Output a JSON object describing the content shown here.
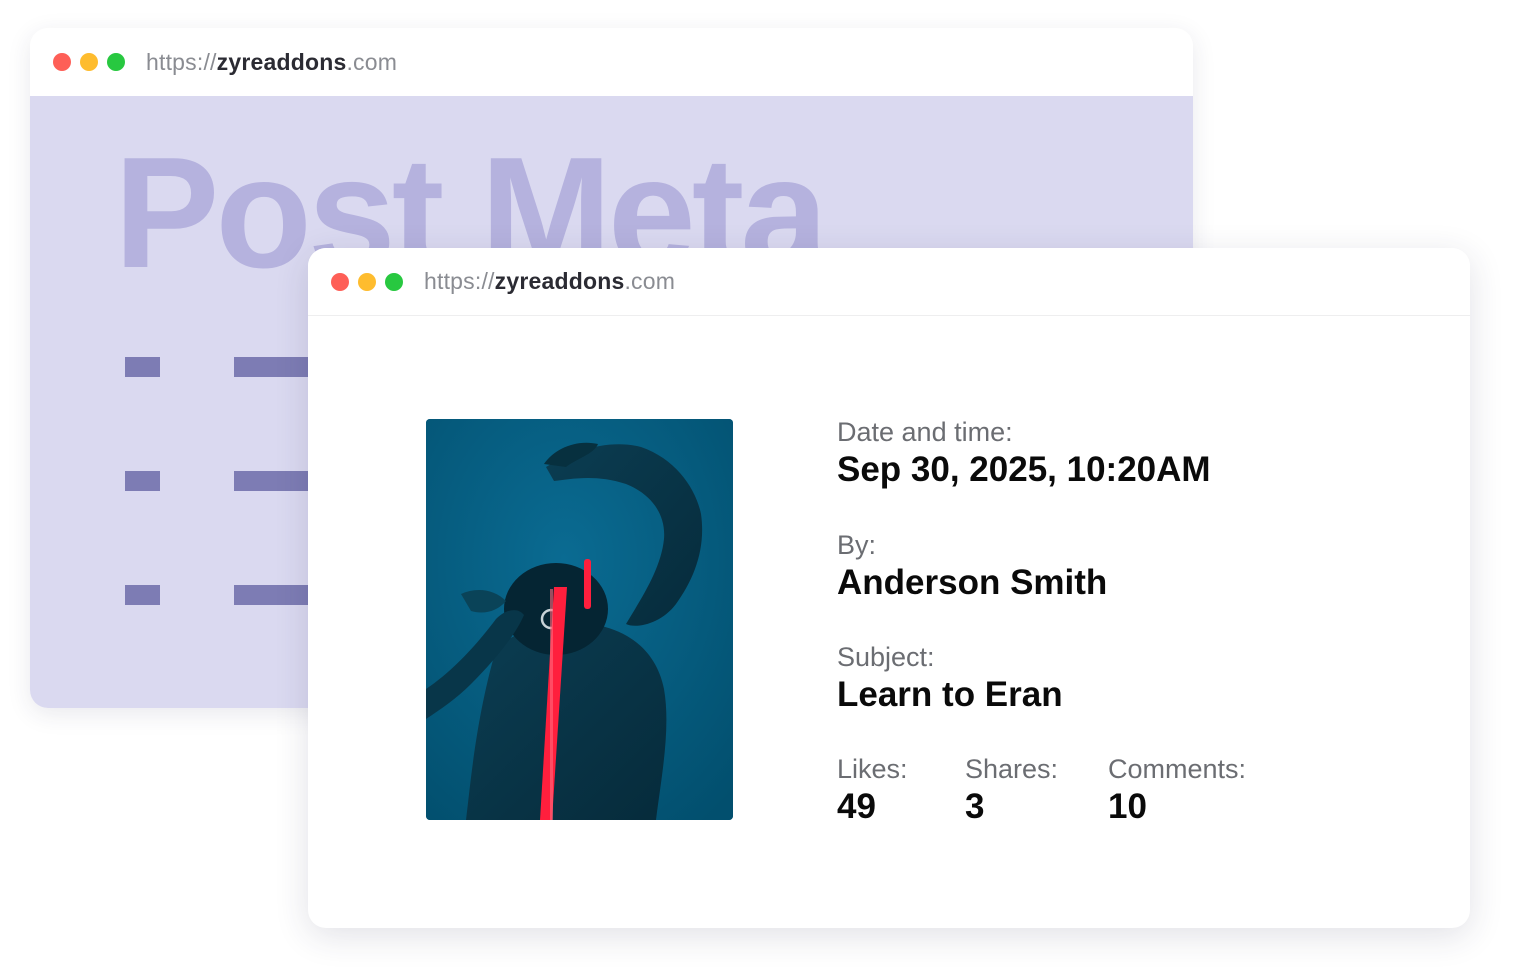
{
  "back_window": {
    "url_prefix": "https://",
    "url_domain": "zyreaddons",
    "url_suffix": ".com",
    "heading": "Post Meta"
  },
  "front_window": {
    "url_prefix": "https://",
    "url_domain": "zyreaddons",
    "url_suffix": ".com"
  },
  "post_meta": {
    "date_label": "Date and time:",
    "date_value": "Sep 30, 2025, 10:20AM",
    "author_label": "By:",
    "author_value": "Anderson Smith",
    "subject_label": "Subject:",
    "subject_value": "Learn to Eran",
    "likes_label": "Likes:",
    "likes_value": "49",
    "shares_label": "Shares:",
    "shares_value": "3",
    "comments_label": "Comments:",
    "comments_value": "10"
  },
  "colors": {
    "back_panel": "#dad9f0",
    "back_heading": "#b5b2de",
    "placeholder_bars": "#7d7cb4",
    "photo_background": "#035d80",
    "neon_accent": "#ff1f3d"
  }
}
